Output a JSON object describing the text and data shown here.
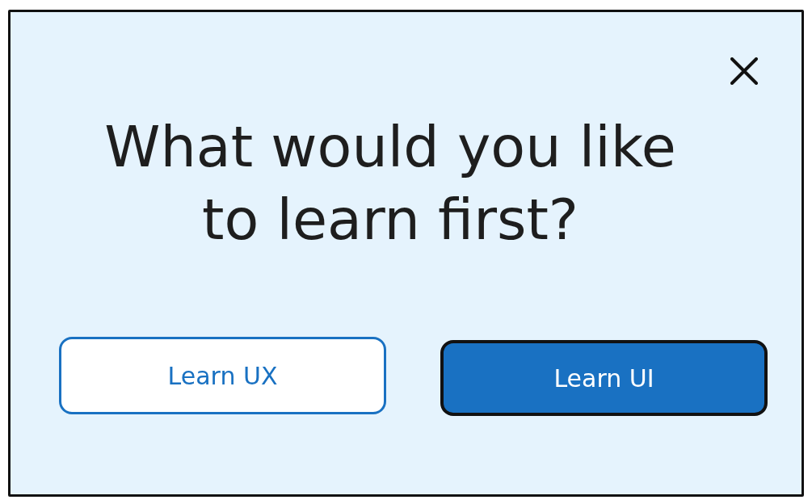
{
  "dialog": {
    "title": "What would you like to learn first?",
    "buttons": [
      {
        "label": "Learn UX",
        "kind": "secondary"
      },
      {
        "label": "Learn UI",
        "kind": "primary"
      }
    ]
  }
}
